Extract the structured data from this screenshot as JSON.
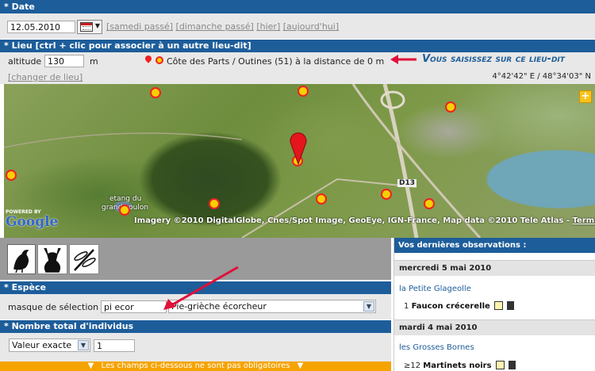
{
  "date_section": {
    "title": "* Date",
    "date_value": "12.05.2010",
    "links": [
      "[samedi passé]",
      "[dimanche passé]",
      "[hier]",
      "[aujourd'hui]"
    ]
  },
  "lieu_section": {
    "title": "* Lieu [ctrl + clic pour associer à un autre lieu-dit]",
    "altitude_label": "altitude",
    "altitude_value": "130",
    "altitude_unit": "m",
    "place_text": "Côte des Parts / Outines (51) à la distance de 0 m",
    "annotation": "Vous saisissez sur ce lieu-dit",
    "change_link": "[changer de lieu]",
    "coordinates": "4°42'42\" E / 48°34'03\" N"
  },
  "map": {
    "powered_by": "POWERED BY",
    "google": "Google",
    "pond_label_1": "etang du",
    "pond_label_2": "grand coulon",
    "road_label": "D13",
    "attribution": "Imagery ©2010 DigitalGlobe, Cnes/Spot Image, GeoEye, IGN-France, Map data ©2010 Tele Atlas - ",
    "terms": "Terms of Use",
    "zoom_symbol": "+"
  },
  "espece_section": {
    "title": "* Espèce",
    "mask_label": "masque de sélection",
    "mask_value": "pi ecor",
    "species_selected": "Pie-grièche écorcheur"
  },
  "nombre_section": {
    "title": "* Nombre total d'individus",
    "type_selected": "Valeur exacte",
    "count_value": "1"
  },
  "footer_note": "Les champs ci-dessous ne sont pas obligatoires",
  "recent": {
    "title": "Vos dernières observations :",
    "days": [
      {
        "date": "mercredi 5 mai 2010",
        "place": "la Petite Glageolle",
        "count": "1",
        "species": "Faucon crécerelle"
      },
      {
        "date": "mardi 4 mai 2010",
        "place": "les Grosses Bornes",
        "count": "≥12",
        "species": "Martinets noirs"
      }
    ]
  },
  "colors": {
    "header_blue": "#1d5d9a",
    "accent_orange": "#f5a300",
    "annotation_red": "#e0103a"
  }
}
